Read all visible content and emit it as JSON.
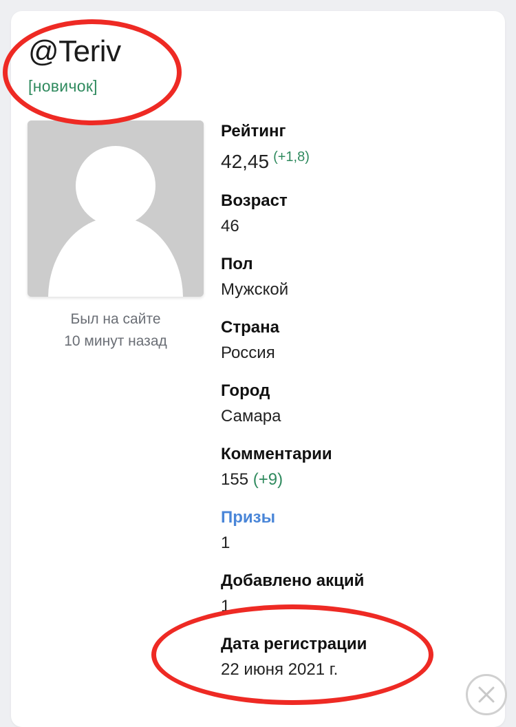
{
  "profile": {
    "username": "@Teriv",
    "rank": "[новичок]",
    "last_seen_line1": "Был на сайте",
    "last_seen_line2": "10 минут назад"
  },
  "stats": {
    "rating": {
      "label": "Рейтинг",
      "value": "42,45",
      "delta": "(+1,8)"
    },
    "age": {
      "label": "Возраст",
      "value": "46"
    },
    "gender": {
      "label": "Пол",
      "value": "Мужской"
    },
    "country": {
      "label": "Страна",
      "value": "Россия"
    },
    "city": {
      "label": "Город",
      "value": "Самара"
    },
    "comments": {
      "label": "Комментарии",
      "value": "155",
      "delta": "(+9)"
    },
    "prizes": {
      "label": "Призы",
      "value": "1"
    },
    "promos_added": {
      "label": "Добавлено акций",
      "value": "1"
    },
    "registration": {
      "label": "Дата регистрации",
      "value": "22 июня 2021 г."
    }
  },
  "icons": {
    "avatar": "default-user-avatar-icon",
    "close": "close-icon"
  },
  "colors": {
    "accent_green": "#2f8a5e",
    "link_blue": "#4a86d8",
    "annotation_red": "#ee2a24"
  }
}
